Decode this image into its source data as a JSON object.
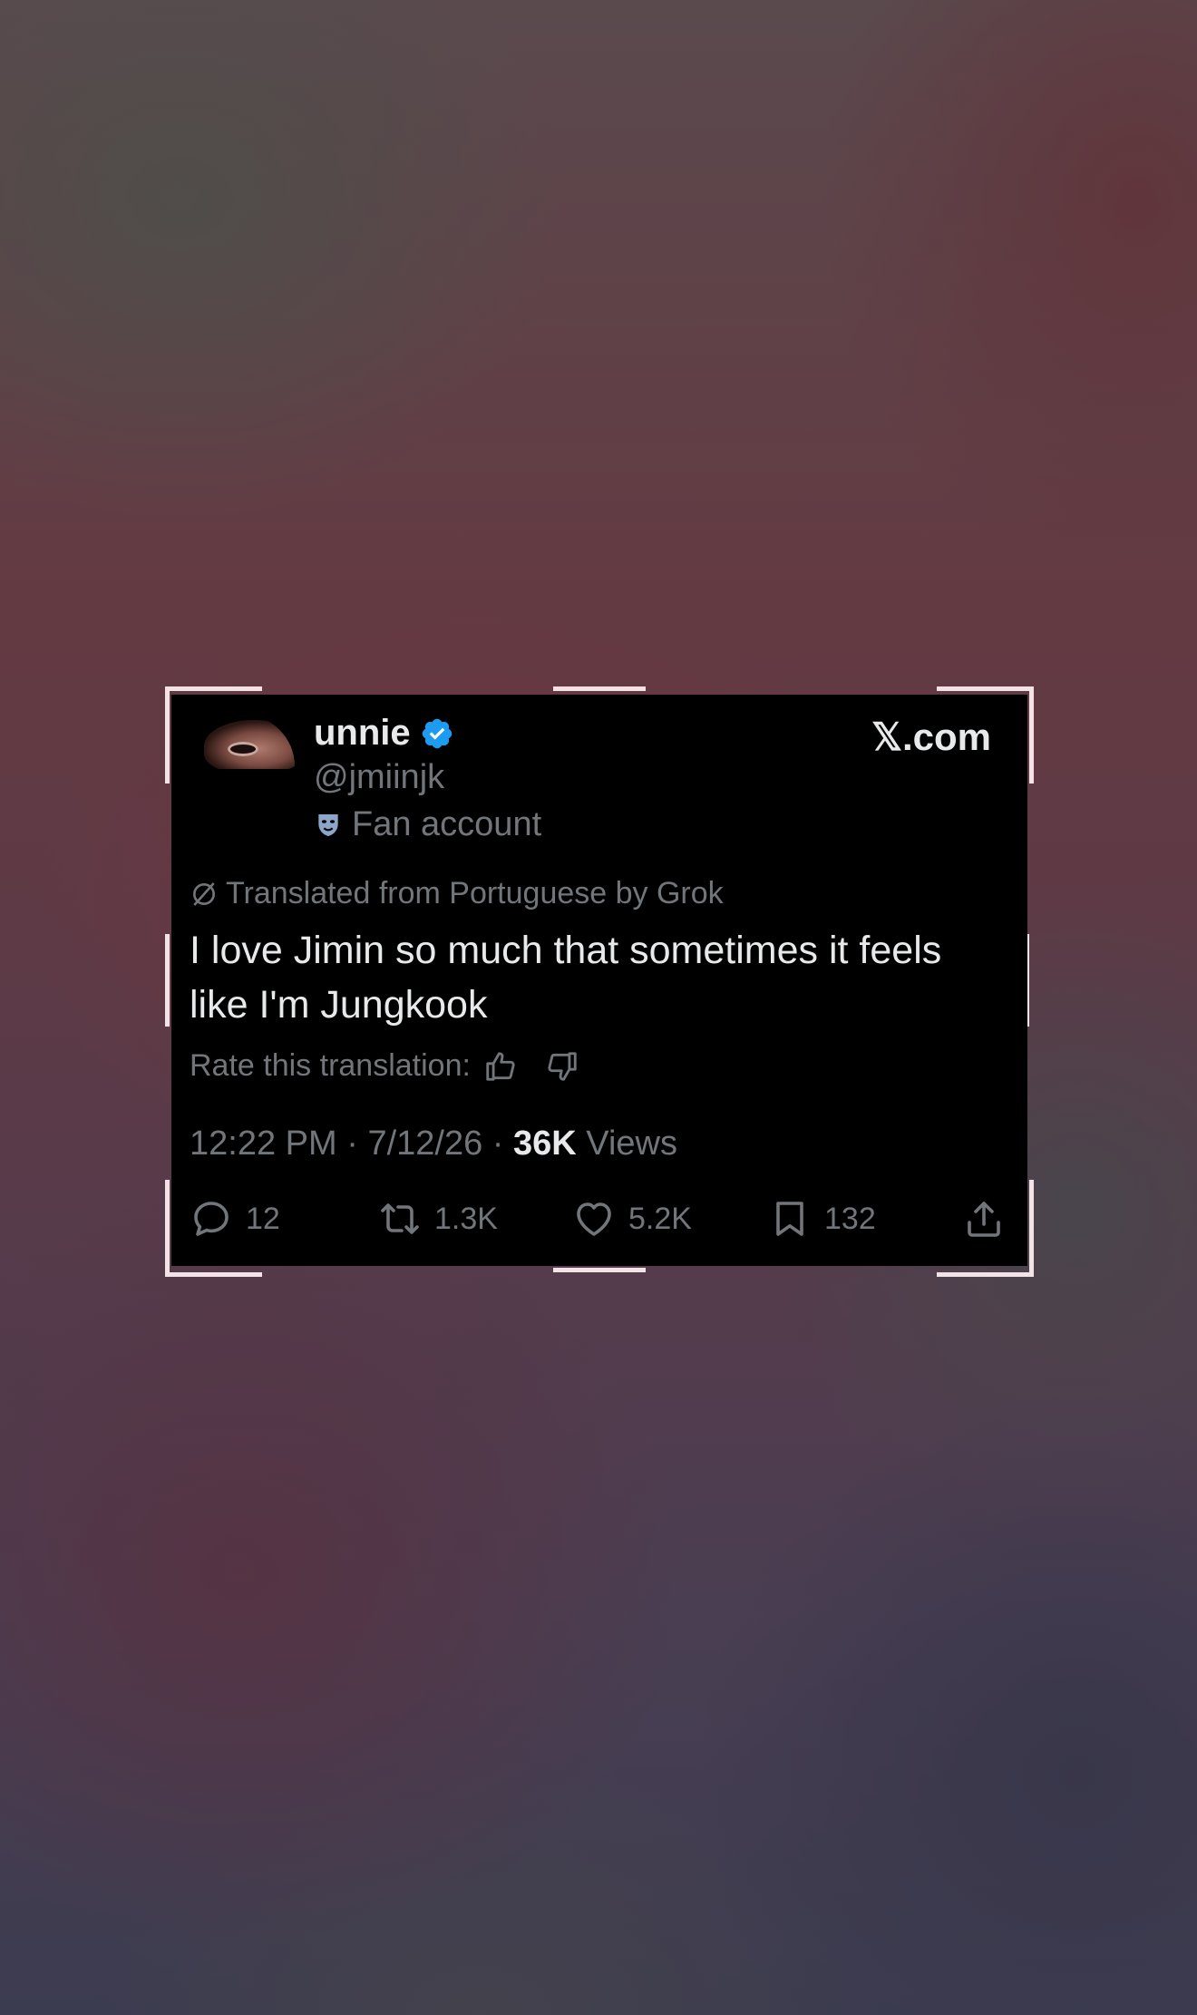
{
  "tweet": {
    "display_name": "unnie",
    "handle": "@jmiinjk",
    "affiliation": "Fan account",
    "brand": "𝕏.com",
    "translation_note": "Translated from Portuguese by Grok",
    "text": "I love Jimin so much that sometimes it feels like I'm Jungkook",
    "rate_label": "Rate this translation:",
    "time": "12:22 PM",
    "date": "7/12/26",
    "views_count": "36K",
    "views_label": "Views",
    "stats": {
      "replies": "12",
      "reposts": "1.3K",
      "likes": "5.2K",
      "bookmarks": "132"
    },
    "icons": {
      "verified": "verified-badge-icon",
      "affiliation": "mask-icon",
      "translation": "grok-icon",
      "thumbs_up": "thumbs-up-icon",
      "thumbs_down": "thumbs-down-icon",
      "reply": "reply-icon",
      "repost": "repost-icon",
      "like": "heart-icon",
      "bookmark": "bookmark-icon",
      "share": "share-icon"
    },
    "colors": {
      "card_background": "#000000",
      "primary_text": "#e7e9ea",
      "secondary_text": "#71767b",
      "verified_blue": "#1d9bf0"
    }
  }
}
